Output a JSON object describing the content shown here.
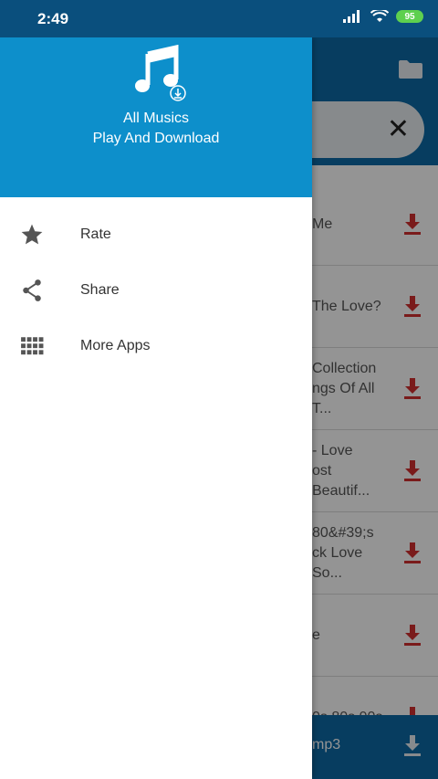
{
  "status_bar": {
    "time": "2:49",
    "battery": "95"
  },
  "background_app": {
    "rows": [
      {
        "title": "Me"
      },
      {
        "title": "The Love?"
      },
      {
        "title": "Collection\nngs Of All T..."
      },
      {
        "title": "- Love\nost Beautif..."
      },
      {
        "title": "80&#39;s\nck Love So..."
      },
      {
        "title": "e"
      },
      {
        "title": "0s 80s 90s"
      }
    ],
    "bottom_bar": {
      "title": "mp3"
    }
  },
  "drawer": {
    "title": "All Musics",
    "subtitle": "Play And Download",
    "menu": [
      {
        "label": "Rate",
        "icon": "star-icon"
      },
      {
        "label": "Share",
        "icon": "share-icon"
      },
      {
        "label": "More Apps",
        "icon": "grid-icon"
      }
    ]
  },
  "colors": {
    "status_bar": "#0a4f7d",
    "app_primary": "#0d6aa6",
    "drawer_header": "#0d8fcb",
    "download_red": "#d32f2f"
  }
}
